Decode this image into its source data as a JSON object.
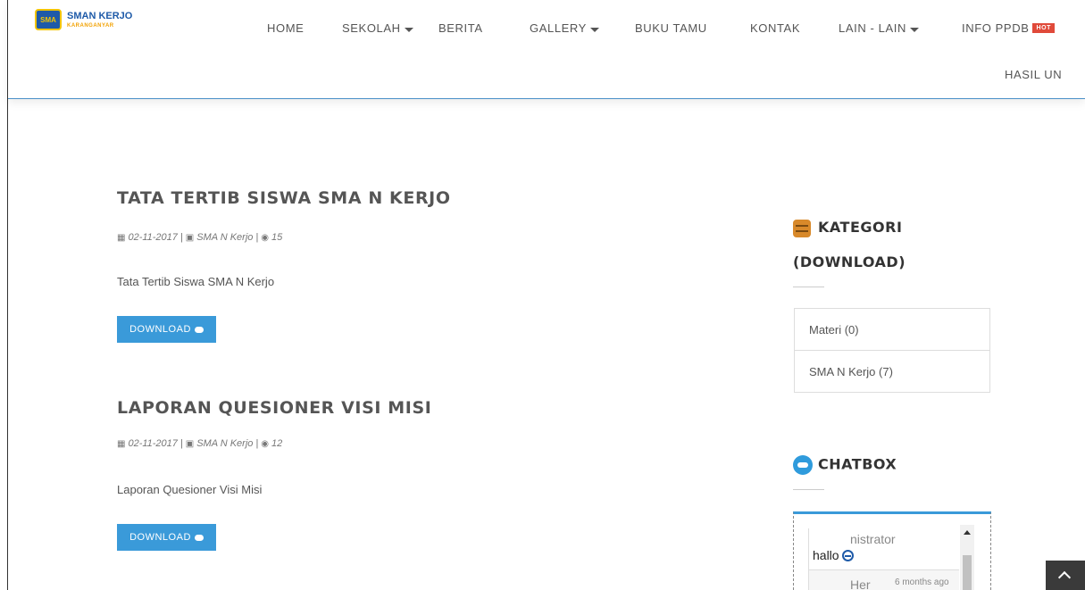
{
  "header": {
    "logo": {
      "title": "SMAN KERJO",
      "subtitle": "KARANGANYAR",
      "badge_text": "SMA"
    },
    "nav": [
      {
        "label": "HOME",
        "has_caret": false
      },
      {
        "label": "SEKOLAH",
        "has_caret": true
      },
      {
        "label": "BERITA",
        "has_caret": false
      },
      {
        "label": "GALLERY",
        "has_caret": true
      },
      {
        "label": "BUKU TAMU",
        "has_caret": false
      },
      {
        "label": "KONTAK",
        "has_caret": false
      },
      {
        "label": "LAIN - LAIN",
        "has_caret": true
      },
      {
        "label": "INFO PPDB",
        "badge": "HOT"
      },
      {
        "label": "HASIL UN",
        "has_caret": false
      }
    ]
  },
  "posts": [
    {
      "title": "TATA TERTIB SISWA SMA N KERJO",
      "date": "02-11-2017",
      "sep1": "|",
      "category": "SMA N Kerjo",
      "sep2": "|",
      "views": "15",
      "description": "Tata Tertib Siswa SMA N Kerjo",
      "button": "DOWNLOAD"
    },
    {
      "title": "LAPORAN QUESIONER VISI MISI",
      "date": "02-11-2017",
      "sep1": "|",
      "category": "SMA N Kerjo",
      "sep2": "|",
      "views": "12",
      "description": "Laporan Quesioner Visi Misi",
      "button": "DOWNLOAD"
    }
  ],
  "sidebar": {
    "kategori": {
      "title_line1": "KATEGORI",
      "title_line2": "(DOWNLOAD)",
      "icon": "archive-box-icon",
      "items": [
        "Materi (0)",
        "SMA N Kerjo (7)"
      ]
    },
    "chatbox": {
      "title": "CHATBOX",
      "icon": "chat-bubble-icon",
      "messages": [
        {
          "name": "nistrator",
          "text": "hallo"
        },
        {
          "name": "Her",
          "time": "6 months ago"
        }
      ]
    }
  },
  "colors": {
    "accent": "#3a9ad9",
    "hot_badge": "#e04a3a",
    "header_border": "#4a90c8",
    "kategori_icon": "#d8892a"
  }
}
